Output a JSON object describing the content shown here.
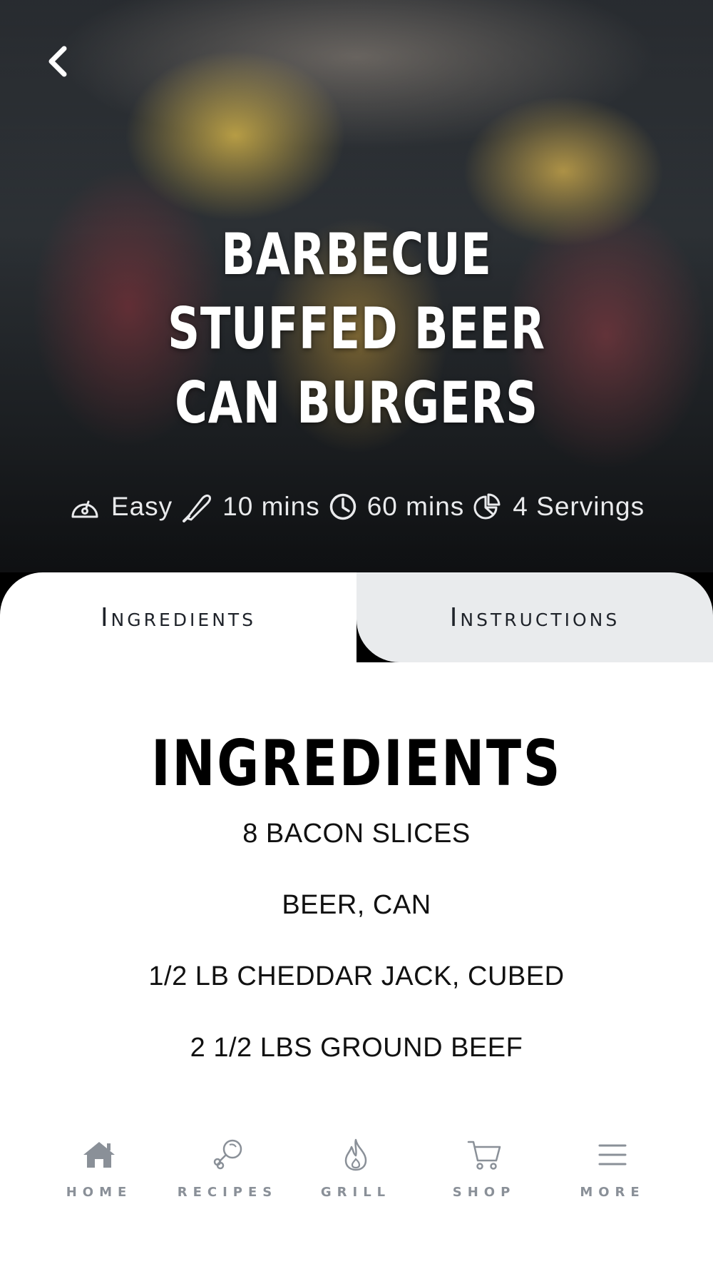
{
  "recipe": {
    "title": "Barbecue Stuffed Beer Can Burgers",
    "meta": {
      "difficulty": "Easy",
      "prep_time": "10 mins",
      "cook_time": "60 mins",
      "servings": "4 Servings"
    }
  },
  "icons": {
    "back": "chevron-left-icon",
    "difficulty": "gauge-icon",
    "prep": "knife-icon",
    "cook": "clock-icon",
    "servings": "pie-chart-icon"
  },
  "tabs": [
    {
      "label": "Ingredients",
      "active": true
    },
    {
      "label": "Instructions",
      "active": false
    }
  ],
  "ingredients": {
    "heading": "INGREDIENTS",
    "items": [
      "8 BACON SLICES",
      "BEER, CAN",
      "1/2 LB CHEDDAR JACK, CUBED",
      "2 1/2 LBS GROUND BEEF"
    ]
  },
  "nav": {
    "items": [
      {
        "label": "HOME",
        "icon": "home-icon",
        "active": true
      },
      {
        "label": "RECIPES",
        "icon": "drumstick-icon",
        "active": false
      },
      {
        "label": "GRILL",
        "icon": "flame-icon",
        "active": false
      },
      {
        "label": "SHOP",
        "icon": "cart-icon",
        "active": false
      },
      {
        "label": "MORE",
        "icon": "menu-icon",
        "active": false
      }
    ]
  },
  "colors": {
    "tab_inactive_bg": "#e9ebed",
    "nav_icon": "#8a9098",
    "text_dark": "#111111"
  }
}
